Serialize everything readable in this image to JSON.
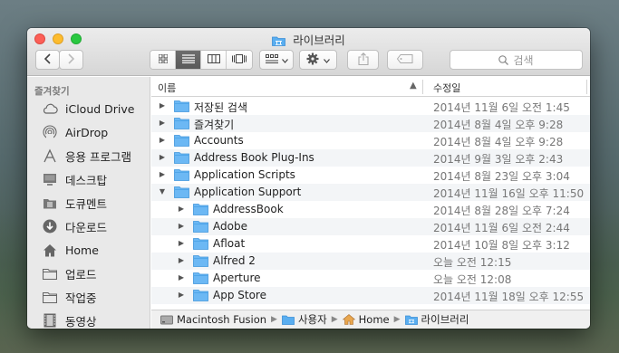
{
  "window": {
    "title": "라이브러리"
  },
  "toolbar": {
    "back_icon": "chevron-left-icon",
    "forward_icon": "chevron-right-icon",
    "search_placeholder": "검색"
  },
  "sidebar": {
    "heading": "즐겨찾기",
    "items": [
      {
        "label": "iCloud Drive",
        "icon": "cloud-icon"
      },
      {
        "label": "AirDrop",
        "icon": "airdrop-icon"
      },
      {
        "label": "응용 프로그램",
        "icon": "applications-icon"
      },
      {
        "label": "데스크탑",
        "icon": "desktop-icon"
      },
      {
        "label": "도큐멘트",
        "icon": "documents-icon"
      },
      {
        "label": "다운로드",
        "icon": "downloads-icon"
      },
      {
        "label": "Home",
        "icon": "home-icon"
      },
      {
        "label": "업로드",
        "icon": "folder-icon"
      },
      {
        "label": "작업중",
        "icon": "folder-icon"
      },
      {
        "label": "동영상",
        "icon": "movies-icon"
      }
    ]
  },
  "columns": {
    "name": "이름",
    "modified": "수정일"
  },
  "rows": [
    {
      "name": "저장된 검색",
      "date": "2014년 11월 6일 오전 1:45",
      "level": 0,
      "expanded": false
    },
    {
      "name": "즐겨찾기",
      "date": "2014년 8월 4일 오후 9:28",
      "level": 0,
      "expanded": false
    },
    {
      "name": "Accounts",
      "date": "2014년 8월 4일 오후 9:28",
      "level": 0,
      "expanded": false
    },
    {
      "name": "Address Book Plug-Ins",
      "date": "2014년 9월 3일 오후 2:43",
      "level": 0,
      "expanded": false
    },
    {
      "name": "Application Scripts",
      "date": "2014년 8월 23일 오후 3:04",
      "level": 0,
      "expanded": false
    },
    {
      "name": "Application Support",
      "date": "2014년 11월 16일 오후 11:50",
      "level": 0,
      "expanded": true
    },
    {
      "name": "AddressBook",
      "date": "2014년 8월 28일 오후 7:24",
      "level": 1,
      "expanded": false
    },
    {
      "name": "Adobe",
      "date": "2014년 11월 6일 오전 2:44",
      "level": 1,
      "expanded": false
    },
    {
      "name": "Afloat",
      "date": "2014년 10월 8일 오후 3:12",
      "level": 1,
      "expanded": false
    },
    {
      "name": "Alfred 2",
      "date": "오늘 오전 12:15",
      "level": 1,
      "expanded": false
    },
    {
      "name": "Aperture",
      "date": "오늘 오전 12:08",
      "level": 1,
      "expanded": false
    },
    {
      "name": "App Store",
      "date": "2014년 11월 18일 오후 12:55",
      "level": 1,
      "expanded": false
    }
  ],
  "pathbar": [
    {
      "label": "Macintosh Fusion",
      "icon": "hard-drive-icon"
    },
    {
      "label": "사용자",
      "icon": "folder-icon"
    },
    {
      "label": "Home",
      "icon": "home-icon"
    },
    {
      "label": "라이브러리",
      "icon": "library-folder-icon"
    }
  ]
}
